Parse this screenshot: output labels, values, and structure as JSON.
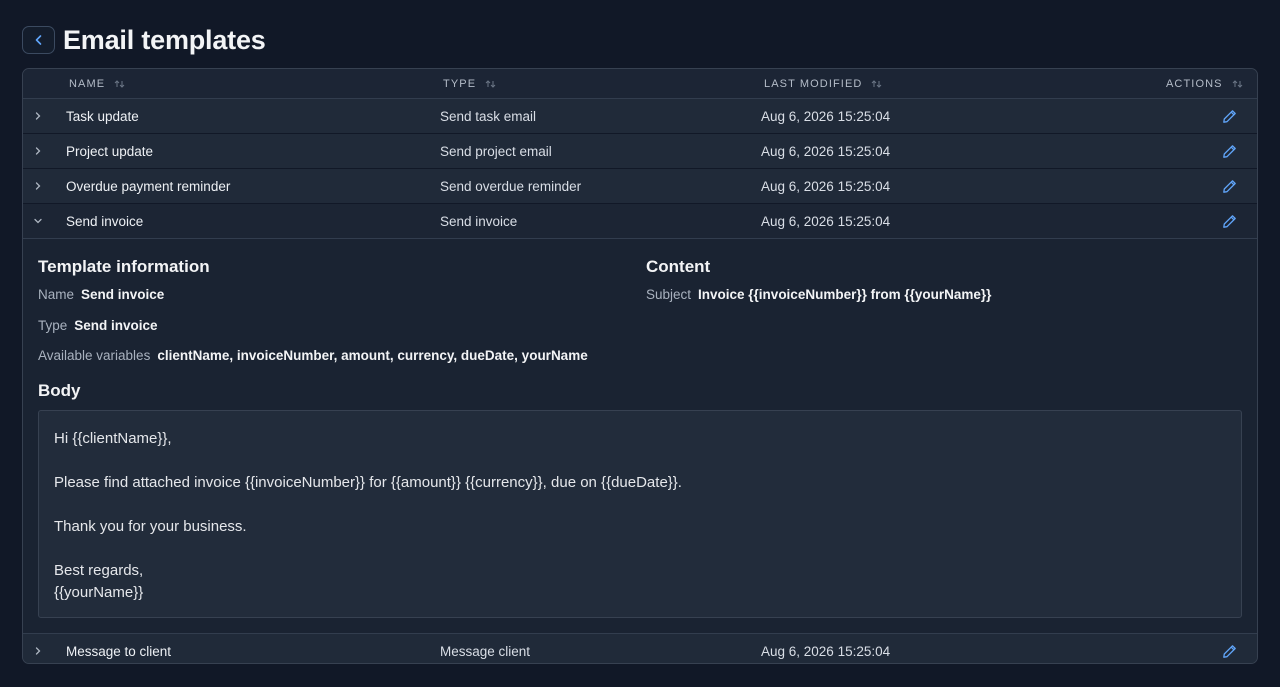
{
  "page": {
    "title": "Email templates"
  },
  "table": {
    "columns": [
      {
        "key": "name",
        "label": "NAME"
      },
      {
        "key": "type",
        "label": "TYPE"
      },
      {
        "key": "modified",
        "label": "LAST MODIFIED"
      },
      {
        "key": "actions",
        "label": "ACTIONS"
      }
    ],
    "rows": [
      {
        "name": "Task update",
        "type": "Send task email",
        "modified": "Aug 6, 2026 15:25:04",
        "expanded": false
      },
      {
        "name": "Project update",
        "type": "Send project email",
        "modified": "Aug 6, 2026 15:25:04",
        "expanded": false
      },
      {
        "name": "Overdue payment reminder",
        "type": "Send overdue reminder",
        "modified": "Aug 6, 2026 15:25:04",
        "expanded": false
      },
      {
        "name": "Send invoice",
        "type": "Send invoice",
        "modified": "Aug 6, 2026 15:25:04",
        "expanded": true
      },
      {
        "name": "Message to client",
        "type": "Message client",
        "modified": "Aug 6, 2026 15:25:04",
        "expanded": false
      }
    ]
  },
  "detail": {
    "info_title": "Template information",
    "name_label": "Name",
    "name_value": "Send invoice",
    "type_label": "Type",
    "type_value": "Send invoice",
    "vars_label": "Available variables",
    "vars_value": "clientName, invoiceNumber, amount, currency, dueDate, yourName",
    "content_title": "Content",
    "subject_label": "Subject",
    "subject_value": "Invoice {{invoiceNumber}} from {{yourName}}",
    "body_title": "Body",
    "body_lines": [
      "Hi {{clientName}},",
      "",
      "Please find attached invoice {{invoiceNumber}} for {{amount}} {{currency}}, due on {{dueDate}}.",
      "",
      "Thank you for your business.",
      "",
      "Best regards,",
      "{{yourName}}"
    ]
  },
  "colors": {
    "accent": "#60a5fa",
    "background": "#111827",
    "panel": "#1e2837"
  },
  "icons": {
    "back": "chevron-left-icon",
    "sort": "sort-icon",
    "expand": "chevron-right-icon",
    "collapse": "chevron-down-icon",
    "edit": "pencil-icon"
  }
}
